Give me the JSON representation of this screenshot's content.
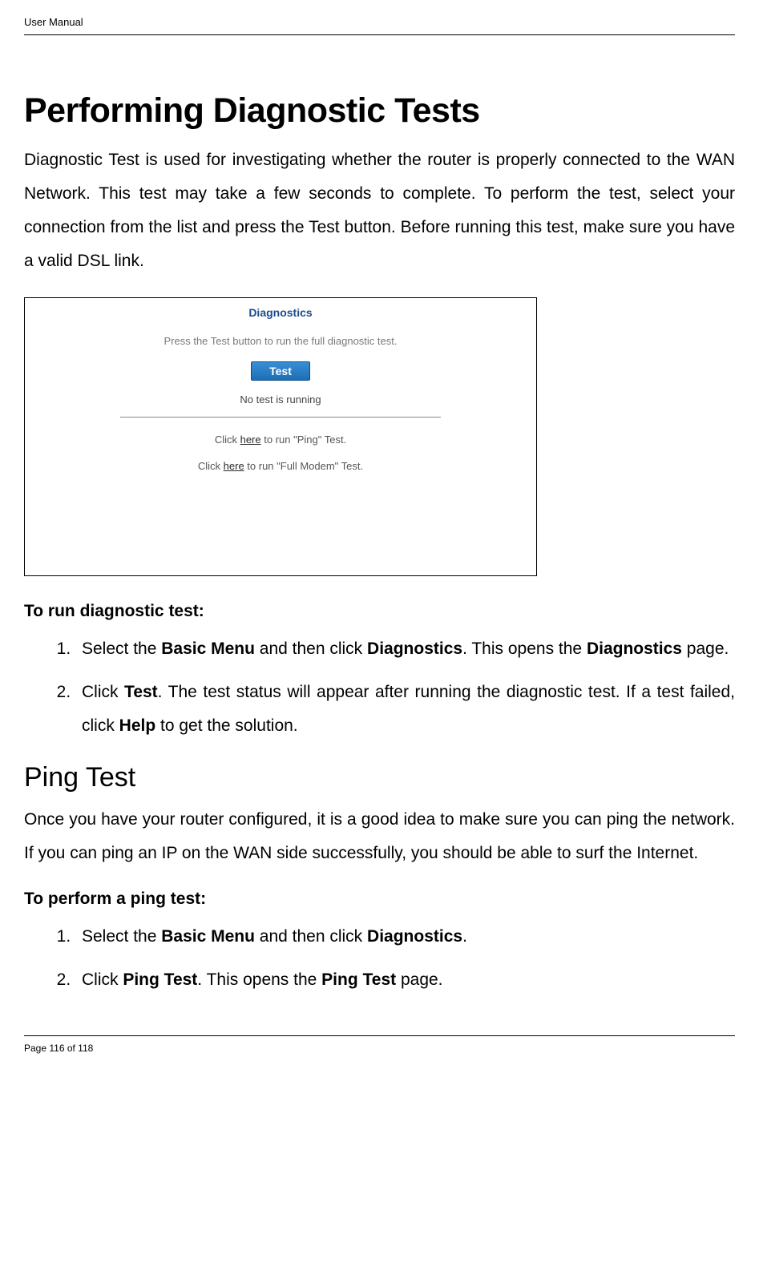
{
  "header": {
    "title": "User Manual"
  },
  "main": {
    "title": "Performing Diagnostic Tests",
    "intro": "Diagnostic Test is used for investigating whether the router is properly connected to the WAN Network. This test may take a few seconds to complete. To perform the test, select your connection from the list and press the Test button. Before running this test, make sure you have a valid DSL link."
  },
  "screenshot": {
    "title": "Diagnostics",
    "instruction": "Press the Test button to run the full diagnostic test.",
    "button_label": "Test",
    "status": "No test is running",
    "link1_pre": "Click ",
    "link1_here": "here",
    "link1_post": " to run \"Ping\" Test.",
    "link2_pre": "Click ",
    "link2_here": "here",
    "link2_post": " to run \"Full Modem\" Test."
  },
  "diag_section": {
    "heading": "To run diagnostic test:",
    "step1_a": "Select the ",
    "step1_b": "Basic Menu",
    "step1_c": " and then click ",
    "step1_d": "Diagnostics",
    "step1_e": ". This opens the ",
    "step1_f": "Diagnostics",
    "step1_g": " page.",
    "step2_a": "Click ",
    "step2_b": "Test",
    "step2_c": ". The test status will appear after running the diagnostic test. If a test failed, click ",
    "step2_d": "Help",
    "step2_e": " to get the solution."
  },
  "ping_section": {
    "title": "Ping Test",
    "intro": "Once you have your router configured, it is a good idea to make sure you can ping the network. If you can ping an IP on the WAN side successfully, you should be able to surf the Internet.",
    "heading": "To perform a ping test:",
    "step1_a": "Select the ",
    "step1_b": "Basic Menu",
    "step1_c": " and then click ",
    "step1_d": "Diagnostics",
    "step1_e": ".",
    "step2_a": "Click ",
    "step2_b": "Ping Test",
    "step2_c": ". This opens the ",
    "step2_d": "Ping Test",
    "step2_e": " page."
  },
  "footer": {
    "page_text": "Page 116 of 118"
  }
}
